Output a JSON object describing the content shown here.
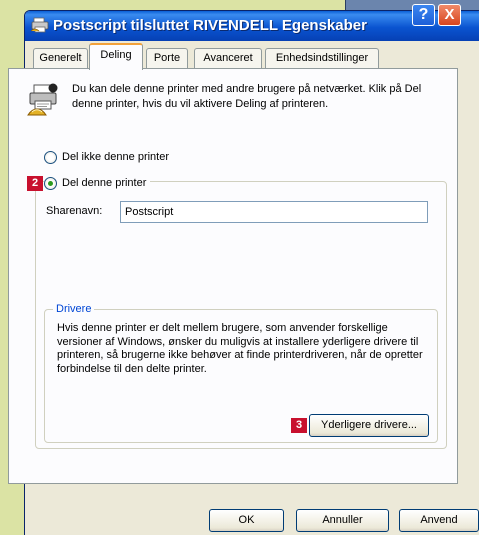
{
  "window": {
    "title": "Postscript tilsluttet RIVENDELL Egenskaber",
    "help_label": "?",
    "close_label": "X"
  },
  "tabs": [
    {
      "label": "Generelt",
      "active": false
    },
    {
      "label": "Deling",
      "active": true
    },
    {
      "label": "Porte",
      "active": false
    },
    {
      "label": "Avanceret",
      "active": false
    },
    {
      "label": "Enhedsindstillinger",
      "active": false
    }
  ],
  "sharing": {
    "intro_text": "Du kan dele denne printer med andre brugere på netværket. Klik på Del denne printer, hvis du vil aktivere Deling af printeren.",
    "option_no_share": "Del ikke denne printer",
    "option_share": "Del denne printer",
    "selected": "share",
    "share_name_label": "Sharenavn:",
    "share_name_value": "Postscript"
  },
  "drivers": {
    "legend": "Drivere",
    "text": "Hvis denne printer er delt mellem brugere, som anvender forskellige versioner af Windows, ønsker du muligvis at installere yderligere drivere til printeren, så brugerne ikke behøver at finde printerdriveren, når de opretter forbindelse til den delte printer.",
    "additional_drivers_button": "Yderligere drivere..."
  },
  "callouts": {
    "badge_2": "2",
    "badge_3": "3"
  },
  "buttons": {
    "ok": "OK",
    "cancel": "Annuller",
    "apply": "Anvend"
  },
  "colors": {
    "titlebar": "#0a54d0",
    "callout_badge": "#c8102e",
    "background": "#dbe3a4",
    "dialog_face": "#ece9d8"
  }
}
